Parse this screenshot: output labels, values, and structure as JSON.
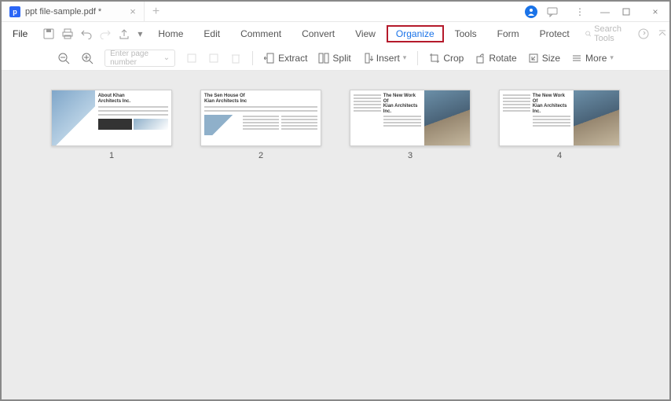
{
  "titlebar": {
    "tab_title": "ppt file-sample.pdf *",
    "app_icon_letter": "p"
  },
  "menu": {
    "file": "File",
    "items": [
      "Home",
      "Edit",
      "Comment",
      "Convert",
      "View",
      "Organize",
      "Tools",
      "Form",
      "Protect"
    ],
    "active_index": 5,
    "search_placeholder": "Search Tools"
  },
  "toolbar": {
    "page_placeholder": "Enter page number",
    "extract": "Extract",
    "split": "Split",
    "insert": "Insert",
    "crop": "Crop",
    "rotate": "Rotate",
    "size": "Size",
    "more": "More"
  },
  "thumbnails": [
    {
      "num": "1",
      "title": "About Khan\nArchitects Inc."
    },
    {
      "num": "2",
      "title": "The Sen House Of\nKian Architects Inc"
    },
    {
      "num": "3",
      "title": "The New Work Of\nKian Architects Inc."
    },
    {
      "num": "4",
      "title": "The New Work Of\nKian Architects Inc."
    }
  ],
  "colors": {
    "accent": "#1a73e8",
    "highlight_border": "#b51a2b"
  }
}
